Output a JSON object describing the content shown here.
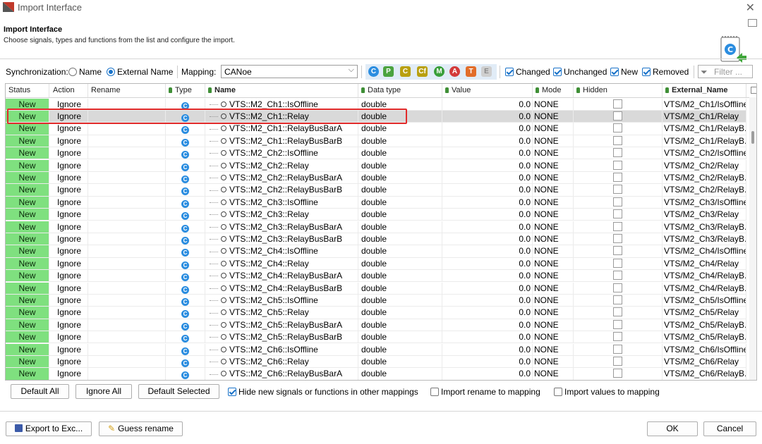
{
  "window": {
    "title": "Import Interface"
  },
  "header": {
    "title": "Import Interface",
    "subtitle": "Choose signals, types and functions from the list and configure the import."
  },
  "toolbar": {
    "sync_label": "Synchronization:",
    "sync_options": [
      "Name",
      "External Name"
    ],
    "sync_selected": "External Name",
    "mapping_label": "Mapping:",
    "mapping_value": "CANoe",
    "filters": [
      {
        "label": "Changed",
        "checked": true
      },
      {
        "label": "Unchanged",
        "checked": true
      },
      {
        "label": "New",
        "checked": true
      },
      {
        "label": "Removed",
        "checked": true
      }
    ],
    "filter_placeholder": "Filter ..."
  },
  "table": {
    "columns": {
      "status": "Status",
      "action": "Action",
      "rename": "Rename",
      "type": "Type",
      "name": "Name",
      "data_type": "Data type",
      "value": "Value",
      "mode": "Mode",
      "hidden": "Hidden",
      "external_name": "External_Name"
    },
    "rows": [
      {
        "status": "New",
        "action": "Ignore",
        "name": "VTS::M2_Ch1::IsOffline",
        "data_type": "double",
        "value": "0.0",
        "mode": "NONE",
        "ext": "VTS/M2_Ch1/IsOffline"
      },
      {
        "status": "New",
        "action": "Ignore",
        "name": "VTS::M2_Ch1::Relay",
        "data_type": "double",
        "value": "0.0",
        "mode": "NONE",
        "ext": "VTS/M2_Ch1/Relay"
      },
      {
        "status": "New",
        "action": "Ignore",
        "name": "VTS::M2_Ch1::RelayBusBarA",
        "data_type": "double",
        "value": "0.0",
        "mode": "NONE",
        "ext": "VTS/M2_Ch1/RelayB..."
      },
      {
        "status": "New",
        "action": "Ignore",
        "name": "VTS::M2_Ch1::RelayBusBarB",
        "data_type": "double",
        "value": "0.0",
        "mode": "NONE",
        "ext": "VTS/M2_Ch1/RelayB..."
      },
      {
        "status": "New",
        "action": "Ignore",
        "name": "VTS::M2_Ch2::IsOffline",
        "data_type": "double",
        "value": "0.0",
        "mode": "NONE",
        "ext": "VTS/M2_Ch2/IsOffline"
      },
      {
        "status": "New",
        "action": "Ignore",
        "name": "VTS::M2_Ch2::Relay",
        "data_type": "double",
        "value": "0.0",
        "mode": "NONE",
        "ext": "VTS/M2_Ch2/Relay"
      },
      {
        "status": "New",
        "action": "Ignore",
        "name": "VTS::M2_Ch2::RelayBusBarA",
        "data_type": "double",
        "value": "0.0",
        "mode": "NONE",
        "ext": "VTS/M2_Ch2/RelayB..."
      },
      {
        "status": "New",
        "action": "Ignore",
        "name": "VTS::M2_Ch2::RelayBusBarB",
        "data_type": "double",
        "value": "0.0",
        "mode": "NONE",
        "ext": "VTS/M2_Ch2/RelayB..."
      },
      {
        "status": "New",
        "action": "Ignore",
        "name": "VTS::M2_Ch3::IsOffline",
        "data_type": "double",
        "value": "0.0",
        "mode": "NONE",
        "ext": "VTS/M2_Ch3/IsOffline"
      },
      {
        "status": "New",
        "action": "Ignore",
        "name": "VTS::M2_Ch3::Relay",
        "data_type": "double",
        "value": "0.0",
        "mode": "NONE",
        "ext": "VTS/M2_Ch3/Relay"
      },
      {
        "status": "New",
        "action": "Ignore",
        "name": "VTS::M2_Ch3::RelayBusBarA",
        "data_type": "double",
        "value": "0.0",
        "mode": "NONE",
        "ext": "VTS/M2_Ch3/RelayB..."
      },
      {
        "status": "New",
        "action": "Ignore",
        "name": "VTS::M2_Ch3::RelayBusBarB",
        "data_type": "double",
        "value": "0.0",
        "mode": "NONE",
        "ext": "VTS/M2_Ch3/RelayB..."
      },
      {
        "status": "New",
        "action": "Ignore",
        "name": "VTS::M2_Ch4::IsOffline",
        "data_type": "double",
        "value": "0.0",
        "mode": "NONE",
        "ext": "VTS/M2_Ch4/IsOffline"
      },
      {
        "status": "New",
        "action": "Ignore",
        "name": "VTS::M2_Ch4::Relay",
        "data_type": "double",
        "value": "0.0",
        "mode": "NONE",
        "ext": "VTS/M2_Ch4/Relay"
      },
      {
        "status": "New",
        "action": "Ignore",
        "name": "VTS::M2_Ch4::RelayBusBarA",
        "data_type": "double",
        "value": "0.0",
        "mode": "NONE",
        "ext": "VTS/M2_Ch4/RelayB..."
      },
      {
        "status": "New",
        "action": "Ignore",
        "name": "VTS::M2_Ch4::RelayBusBarB",
        "data_type": "double",
        "value": "0.0",
        "mode": "NONE",
        "ext": "VTS/M2_Ch4/RelayB..."
      },
      {
        "status": "New",
        "action": "Ignore",
        "name": "VTS::M2_Ch5::IsOffline",
        "data_type": "double",
        "value": "0.0",
        "mode": "NONE",
        "ext": "VTS/M2_Ch5/IsOffline"
      },
      {
        "status": "New",
        "action": "Ignore",
        "name": "VTS::M2_Ch5::Relay",
        "data_type": "double",
        "value": "0.0",
        "mode": "NONE",
        "ext": "VTS/M2_Ch5/Relay"
      },
      {
        "status": "New",
        "action": "Ignore",
        "name": "VTS::M2_Ch5::RelayBusBarA",
        "data_type": "double",
        "value": "0.0",
        "mode": "NONE",
        "ext": "VTS/M2_Ch5/RelayB..."
      },
      {
        "status": "New",
        "action": "Ignore",
        "name": "VTS::M2_Ch5::RelayBusBarB",
        "data_type": "double",
        "value": "0.0",
        "mode": "NONE",
        "ext": "VTS/M2_Ch5/RelayB..."
      },
      {
        "status": "New",
        "action": "Ignore",
        "name": "VTS::M2_Ch6::IsOffline",
        "data_type": "double",
        "value": "0.0",
        "mode": "NONE",
        "ext": "VTS/M2_Ch6/IsOffline"
      },
      {
        "status": "New",
        "action": "Ignore",
        "name": "VTS::M2_Ch6::Relay",
        "data_type": "double",
        "value": "0.0",
        "mode": "NONE",
        "ext": "VTS/M2_Ch6/Relay"
      },
      {
        "status": "New",
        "action": "Ignore",
        "name": "VTS::M2_Ch6::RelayBusBarA",
        "data_type": "double",
        "value": "0.0",
        "mode": "NONE",
        "ext": "VTS/M2_Ch6/RelayB..."
      }
    ],
    "selected_row": 1
  },
  "buttons": {
    "default_all": "Default All",
    "ignore_all": "Ignore All",
    "default_selected": "Default Selected",
    "export": "Export to Exc...",
    "guess_rename": "Guess rename",
    "ok": "OK",
    "cancel": "Cancel"
  },
  "options": {
    "hide_new": "Hide new signals or functions in other mappings",
    "import_rename": "Import rename to mapping",
    "import_values": "Import values to mapping"
  },
  "colors": {
    "status_new": "#7fe07f",
    "highlight": "#e12b2b",
    "accent": "#1a73c9"
  }
}
